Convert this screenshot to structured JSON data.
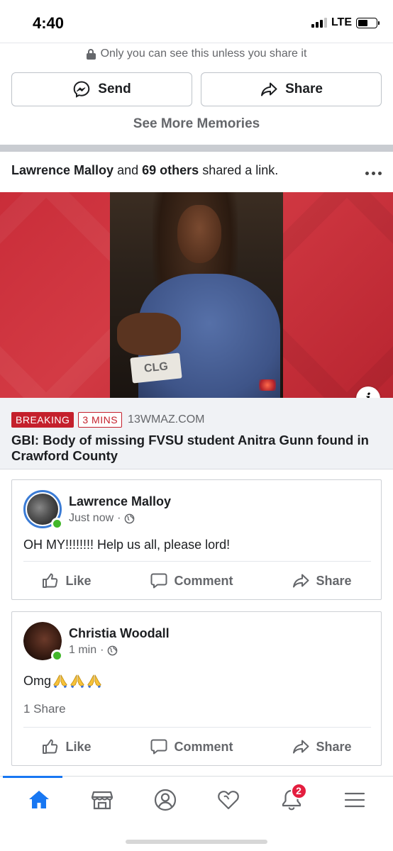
{
  "status_bar": {
    "time": "4:40",
    "network": "LTE"
  },
  "memories": {
    "privacy_text": "Only you can see this unless you share it",
    "send_label": "Send",
    "share_label": "Share",
    "see_more": "See More Memories"
  },
  "shared_header": {
    "name": "Lawrence Malloy",
    "connector": "and",
    "others": "69 others",
    "suffix": "shared a link."
  },
  "link": {
    "photo_plate_text": "CLG",
    "breaking": "BREAKING",
    "age": "3 MINS",
    "domain": "13WMAZ.COM",
    "headline": "GBI: Body of missing FVSU student Anitra Gunn found in Crawford County"
  },
  "posts": [
    {
      "author": "Lawrence Malloy",
      "time": "Just now",
      "text": "OH MY!!!!!!!! Help us all, please lord!",
      "actions": {
        "like": "Like",
        "comment": "Comment",
        "share": "Share"
      }
    },
    {
      "author": "Christia Woodall",
      "time": "1 min",
      "text": "Omg",
      "emoji": [
        "folded-hands",
        "folded-hands",
        "folded-hands"
      ],
      "shares": "1 Share",
      "actions": {
        "like": "Like",
        "comment": "Comment",
        "share": "Share"
      }
    }
  ],
  "tab_bar": {
    "tabs": [
      "home",
      "marketplace",
      "profile",
      "dating",
      "notifications",
      "menu"
    ],
    "active": "home",
    "notifications_count": "2"
  },
  "colors": {
    "accent": "#1877f2",
    "breaking_red": "#c4202c",
    "online_green": "#42b72a",
    "badge_red": "#e41e3f"
  }
}
